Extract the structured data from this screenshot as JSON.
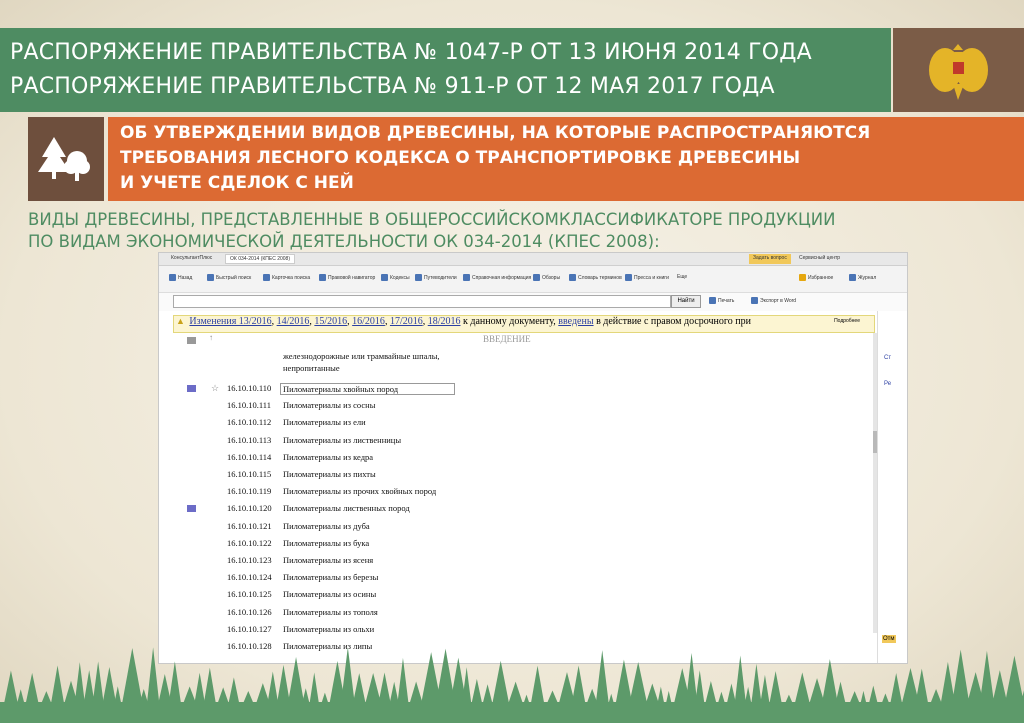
{
  "header": {
    "line1": "РАСПОРЯЖЕНИЕ ПРАВИТЕЛЬСТВА № 1047-Р ОТ 13 ИЮНЯ 2014 ГОДА",
    "line2": "РАСПОРЯЖЕНИЕ ПРАВИТЕЛЬСТВА № 911-Р ОТ 12 МАЯ 2017 ГОДА"
  },
  "subheader": {
    "line1": "ОБ УТВЕРЖДЕНИИ ВИДОВ ДРЕВЕСИНЫ, НА КОТОРЫЕ РАСПРОСТРАНЯЮТСЯ",
    "line2": "ТРЕБОВАНИЯ ЛЕСНОГО КОДЕКСА О ТРАНСПОРТИРОВКЕ ДРЕВЕСИНЫ",
    "line3": " И УЧЕТЕ СДЕЛОК С НЕЙ"
  },
  "intro": {
    "line1": "ВИДЫ ДРЕВЕСИНЫ, ПРЕДСТАВЛЕННЫЕ В ОБЩЕРОССИЙСКОМКЛАССИФИКАТОРЕ ПРОДУКЦИИ",
    "line2": "ПО ВИДАМ ЭКОНОМИЧЕСКОЙ ДЕЯТЕЛЬНОСТИ ОК 034-2014 (КПЕС 2008):"
  },
  "browser": {
    "tab_app": "КонсультантПлюс",
    "tab_doc": "ОК 034-2014 (КПЕС 2008)",
    "search_button": "Найти",
    "toolbar": [
      "Назад",
      "Быстрый поиск",
      "Карточка поиска",
      "Правовой навигатор",
      "Кодексы",
      "Путеводители",
      "Справочная информация",
      "Обзоры",
      "Словарь терминов",
      "Пресса и книги",
      "Еще"
    ],
    "actions": [
      "Печать",
      "Экспорт в Word"
    ],
    "right_tools": [
      "Избранное",
      "Журнал"
    ],
    "top_right": [
      "Задать вопрос",
      "Сервисный центр"
    ]
  },
  "notice": {
    "links": [
      "Изменения 13/2016",
      "14/2016",
      "15/2016",
      "16/2016",
      "17/2016",
      "18/2016"
    ],
    "middle": " к данному документу, ",
    "link_введены": "введены",
    "tail": " в действие с правом досрочного при",
    "lang": "Подробнее"
  },
  "doc": {
    "section": "ВВЕДЕНИЕ",
    "prev_text_1": "железнодорожные или трамвайные шпалы,",
    "prev_text_2": "непропитанные",
    "rows": [
      {
        "code": "16.10.10.110",
        "name": "Пиломатериалы хвойных пород"
      },
      {
        "code": "16.10.10.111",
        "name": "Пиломатериалы из сосны"
      },
      {
        "code": "16.10.10.112",
        "name": "Пиломатериалы из ели"
      },
      {
        "code": "16.10.10.113",
        "name": "Пиломатериалы из лиственницы"
      },
      {
        "code": "16.10.10.114",
        "name": "Пиломатериалы из кедра"
      },
      {
        "code": "16.10.10.115",
        "name": "Пиломатериалы из пихты"
      },
      {
        "code": "16.10.10.119",
        "name": "Пиломатериалы из прочих хвойных пород"
      },
      {
        "code": "16.10.10.120",
        "name": "Пиломатериалы лиственных пород"
      },
      {
        "code": "16.10.10.121",
        "name": "Пиломатериалы из дуба"
      },
      {
        "code": "16.10.10.122",
        "name": "Пиломатериалы из бука"
      },
      {
        "code": "16.10.10.123",
        "name": "Пиломатериалы из ясеня"
      },
      {
        "code": "16.10.10.124",
        "name": "Пиломатериалы из березы"
      },
      {
        "code": "16.10.10.125",
        "name": "Пиломатериалы из осины"
      },
      {
        "code": "16.10.10.126",
        "name": "Пиломатериалы из тополя"
      },
      {
        "code": "16.10.10.127",
        "name": "Пиломатериалы из ольхи"
      },
      {
        "code": "16.10.10.128",
        "name": "Пиломатериалы из липы"
      }
    ]
  },
  "sidepane": {
    "items": [
      "Ст",
      "Ре",
      "Отм"
    ]
  },
  "colors": {
    "header_green": "#4e8c62",
    "emblem_brown": "#7b5c47",
    "subheader_orange": "#dc6a33",
    "icon_brown": "#6e4f3d",
    "forest_green": "#5d9a6a"
  }
}
